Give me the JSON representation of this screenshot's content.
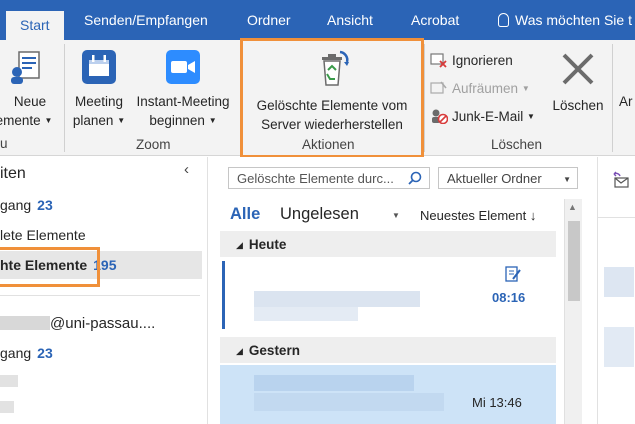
{
  "tabs": [
    "Start",
    "Senden/Empfangen",
    "Ordner",
    "Ansicht",
    "Acrobat"
  ],
  "tell_me": "Was möchten Sie t",
  "ribbon": {
    "new_label_1": "Neue",
    "new_label_2": "emente",
    "meeting_1": "Meeting",
    "meeting_2": "planen",
    "instant_1": "Instant-Meeting",
    "instant_2": "beginnen",
    "restore_1": "Gelöschte Elemente vom",
    "restore_2": "Server wiederherstellen",
    "ignore": "Ignorieren",
    "cleanup": "Aufräumen",
    "junk": "Junk-E-Mail",
    "delete": "Löschen",
    "archive_partial": "Ar",
    "group_new_partial": "u",
    "group_zoom": "Zoom",
    "group_actions": "Aktionen",
    "group_delete": "Löschen"
  },
  "folders": {
    "header_partial": "iten",
    "inbox_partial": "gang",
    "inbox_count": "23",
    "sent_partial": "lete Elemente",
    "deleted_partial": "hte Elemente",
    "deleted_count": "195",
    "account_suffix": "@uni-passau....",
    "inbox2_partial": "gang",
    "inbox2_count": "23"
  },
  "list": {
    "search_placeholder": "Gelöschte Elemente durc...",
    "scope": "Aktueller Ordner",
    "filter_all": "Alle",
    "filter_unread": "Ungelesen",
    "sort": "Neuestes Element",
    "group_today": "Heute",
    "group_yesterday": "Gestern",
    "msg1_time": "08:16",
    "msg2_time": "Mi 13:46"
  },
  "colors": {
    "accent": "#2b64b6",
    "highlight": "#f0903a",
    "selected_row": "#cde3f7"
  }
}
